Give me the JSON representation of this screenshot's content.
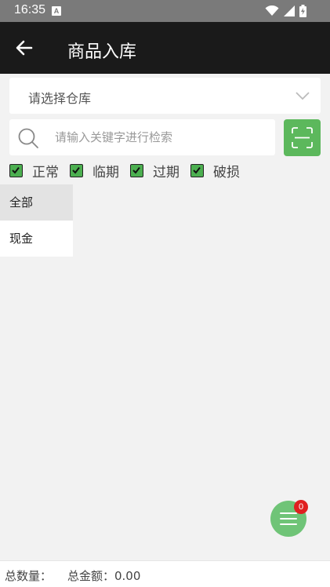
{
  "status_bar": {
    "time": "16:35",
    "notification_icon_letter": "A"
  },
  "app_bar": {
    "title": "商品入库"
  },
  "warehouse": {
    "placeholder": "请选择仓库"
  },
  "search": {
    "placeholder": "请输入关键字进行检索",
    "value": ""
  },
  "filters": [
    {
      "label": "正常",
      "checked": true
    },
    {
      "label": "临期",
      "checked": true
    },
    {
      "label": "过期",
      "checked": true
    },
    {
      "label": "破损",
      "checked": true
    }
  ],
  "categories": [
    {
      "label": "全部",
      "active": true
    },
    {
      "label": "现金",
      "active": false
    }
  ],
  "cart": {
    "badge_count": "0"
  },
  "footer": {
    "total_qty_label": "总数量：",
    "total_amount_label": "总金额：0.00"
  },
  "colors": {
    "accent": "#5cb85c",
    "app_bar": "#1a1a1a",
    "badge": "#e02020"
  }
}
